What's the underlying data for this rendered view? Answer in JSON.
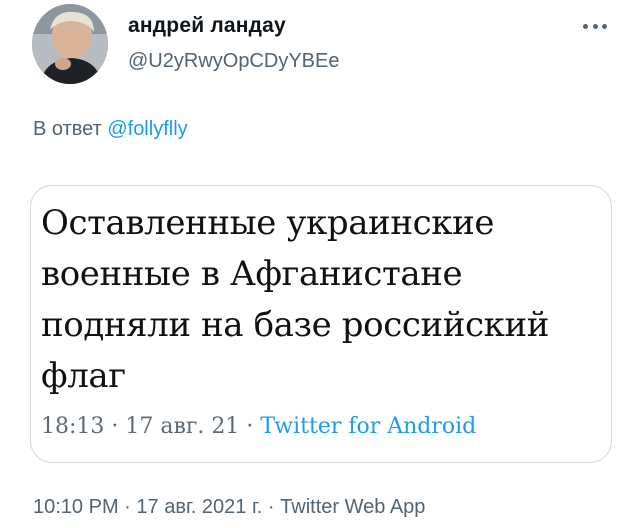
{
  "author": {
    "display_name": "андрей ландау",
    "handle": "@U2yRwyOpCDyYBEe"
  },
  "reply": {
    "prefix": "В ответ",
    "to_handle": "@follyflly"
  },
  "quote": {
    "text": "Оставленные украинские военные в Афганистане подняли на базе российский флаг",
    "time": "18:13",
    "sep1": " · ",
    "date": "17 авг. 21",
    "sep2": " · ",
    "source": "Twitter for Android"
  },
  "meta": {
    "time": "10:10 PM",
    "sep1": " · ",
    "date": "17 авг. 2021 г.",
    "sep2": " · ",
    "source": "Twitter Web App"
  },
  "icons": {
    "more": "more-horizontal-icon"
  },
  "colors": {
    "link": "#1d9bf0",
    "secondary_text": "#536471",
    "border": "#cfd9de"
  }
}
